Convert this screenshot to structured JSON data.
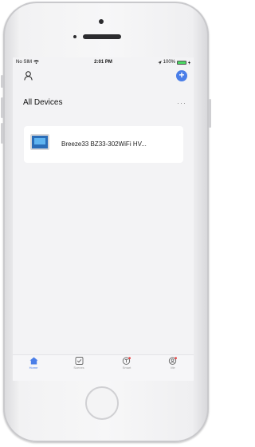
{
  "status_bar": {
    "carrier": "No SIM",
    "time": "2:01 PM",
    "battery_text": "100%",
    "battery_level": 1.0
  },
  "header": {
    "title": "All Devices",
    "more_label": "···",
    "add_label": "+"
  },
  "devices": [
    {
      "name": "Breeze33 BZ33-302WiFi HV..."
    }
  ],
  "tabs": [
    {
      "label": "Home",
      "icon": "home-icon",
      "active": true
    },
    {
      "label": "Scenes",
      "icon": "checkbox-icon",
      "active": false
    },
    {
      "label": "Smart",
      "icon": "smart-icon",
      "active": false
    },
    {
      "label": "Me",
      "icon": "me-icon",
      "active": false
    }
  ],
  "colors": {
    "accent": "#4a7ee8",
    "battery": "#4cd964",
    "badge": "#e84a4a"
  }
}
